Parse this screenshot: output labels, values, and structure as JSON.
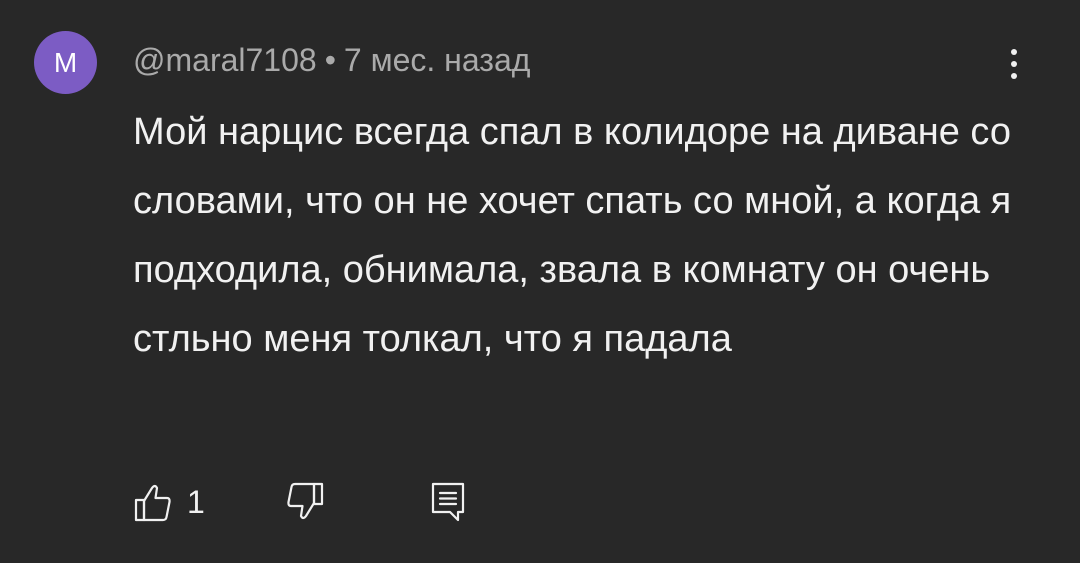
{
  "comment": {
    "avatar_letter": "M",
    "avatar_color": "#7c5cc4",
    "author": "@maral7108",
    "separator": "•",
    "timestamp": "7 мес. назад",
    "text": "Мой нарцис всегда спал в колидоре на диване со словами, что он не хочет спать со мной, а когда я подходила, обнимала, звала в комнату он очень стльно меня толкал, что я падала",
    "like_count": "1"
  },
  "icons": {
    "menu": "more-vert-icon",
    "like": "thumbs-up-icon",
    "dislike": "thumbs-down-icon",
    "reply": "comment-reply-icon"
  },
  "colors": {
    "background": "#282828",
    "text": "#f1f1f1",
    "secondary_text": "#aaaaaa"
  }
}
